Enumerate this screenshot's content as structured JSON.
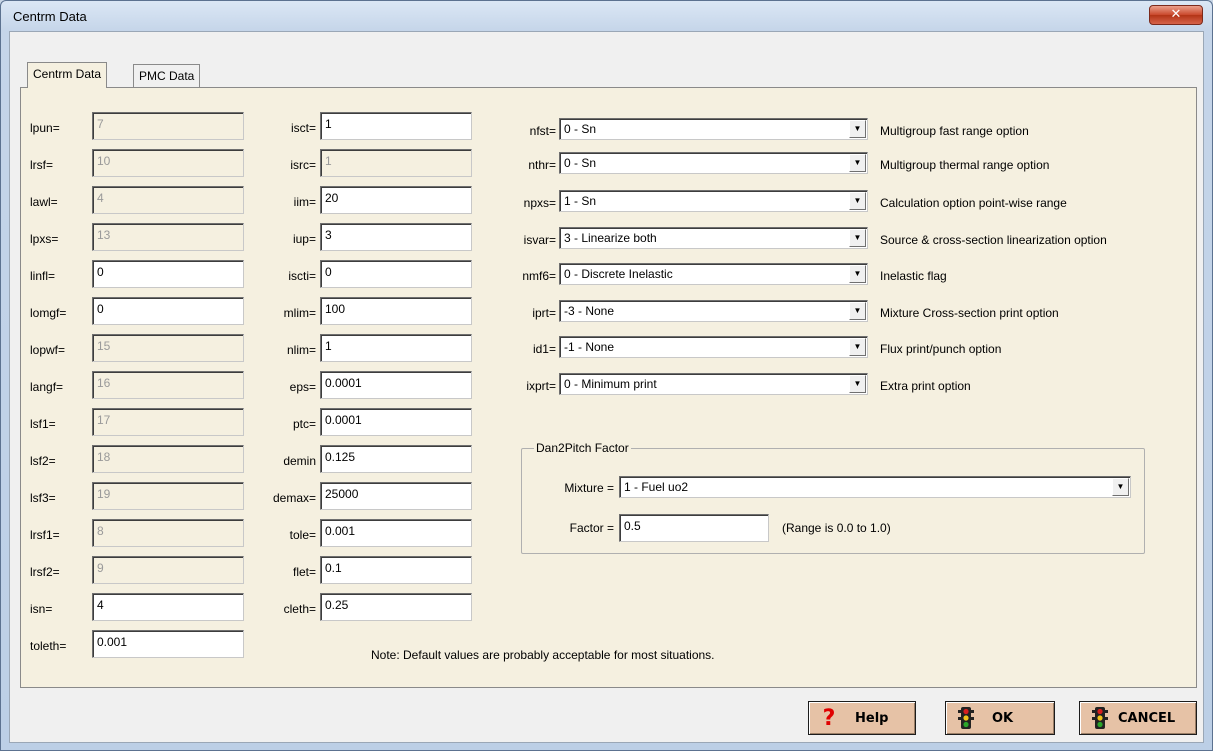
{
  "window": {
    "title": "Centrm Data",
    "close_glyph": "✕"
  },
  "tabs": [
    {
      "label": "Centrm Data",
      "active": true
    },
    {
      "label": "PMC Data",
      "active": false
    }
  ],
  "col1": [
    {
      "label": "lpun=",
      "value": "7",
      "enabled": false
    },
    {
      "label": "lrsf=",
      "value": "10",
      "enabled": false
    },
    {
      "label": "lawl=",
      "value": "4",
      "enabled": false
    },
    {
      "label": "lpxs=",
      "value": "13",
      "enabled": false
    },
    {
      "label": "linfl=",
      "value": "0",
      "enabled": true
    },
    {
      "label": "lomgf=",
      "value": "0",
      "enabled": true
    },
    {
      "label": "lopwf=",
      "value": "15",
      "enabled": false
    },
    {
      "label": "langf=",
      "value": "16",
      "enabled": false
    },
    {
      "label": "lsf1=",
      "value": "17",
      "enabled": false
    },
    {
      "label": "lsf2=",
      "value": "18",
      "enabled": false
    },
    {
      "label": "lsf3=",
      "value": "19",
      "enabled": false
    },
    {
      "label": "lrsf1=",
      "value": "8",
      "enabled": false
    },
    {
      "label": "lrsf2=",
      "value": "9",
      "enabled": false
    },
    {
      "label": "isn=",
      "value": "4",
      "enabled": true
    },
    {
      "label": "toleth=",
      "value": "0.001",
      "enabled": true
    }
  ],
  "col2": [
    {
      "label": "isct=",
      "value": "1",
      "enabled": true
    },
    {
      "label": "isrc=",
      "value": "1",
      "enabled": false
    },
    {
      "label": "iim=",
      "value": "20",
      "enabled": true
    },
    {
      "label": "iup=",
      "value": "3",
      "enabled": true
    },
    {
      "label": "iscti=",
      "value": "0",
      "enabled": true
    },
    {
      "label": "mlim=",
      "value": "100",
      "enabled": true
    },
    {
      "label": "nlim=",
      "value": "1",
      "enabled": true
    },
    {
      "label": "eps=",
      "value": "0.0001",
      "enabled": true
    },
    {
      "label": "ptc=",
      "value": "0.0001",
      "enabled": true
    },
    {
      "label": "demin",
      "value": "0.125",
      "enabled": true
    },
    {
      "label": "demax=",
      "value": "25000",
      "enabled": true
    },
    {
      "label": "tole=",
      "value": "0.001",
      "enabled": true
    },
    {
      "label": "flet=",
      "value": "0.1",
      "enabled": true
    },
    {
      "label": "cleth=",
      "value": "0.25",
      "enabled": true
    }
  ],
  "options": [
    {
      "label": "nfst=",
      "value": "0 - Sn",
      "desc": "Multigroup fast range option"
    },
    {
      "label": "nthr=",
      "value": "0 - Sn",
      "desc": "Multigroup thermal range option"
    },
    {
      "label": "npxs=",
      "value": "1 - Sn",
      "desc": "Calculation option point-wise range"
    },
    {
      "label": "isvar=",
      "value": "3 - Linearize both",
      "desc": "Source & cross-section linearization option"
    },
    {
      "label": "nmf6=",
      "value": "0 - Discrete Inelastic",
      "desc": "Inelastic flag"
    },
    {
      "label": "iprt=",
      "value": "-3 - None",
      "desc": "Mixture Cross-section print option"
    },
    {
      "label": "id1=",
      "value": "-1 - None",
      "desc": "Flux print/punch option"
    },
    {
      "label": "ixprt=",
      "value": "0 - Minimum print",
      "desc": "Extra print option"
    }
  ],
  "dan2pitch": {
    "title": "Dan2Pitch Factor",
    "mixture_label": "Mixture =",
    "mixture_value": "1 - Fuel  uo2",
    "factor_label": "Factor =",
    "factor_value": "0.5",
    "range_hint": "(Range is 0.0 to 1.0)"
  },
  "note": "Note:  Default values are probably acceptable for most situations.",
  "buttons": {
    "help": "Help",
    "ok": "OK",
    "cancel": "CANCEL"
  },
  "icons": {
    "help": "question-mark-icon",
    "ok": "traffic-light-icon",
    "cancel": "traffic-light-icon"
  },
  "colors": {
    "panel_bg": "#f5f0e0",
    "button_bg": "#e6c2a6",
    "help_icon": "#e00000"
  }
}
